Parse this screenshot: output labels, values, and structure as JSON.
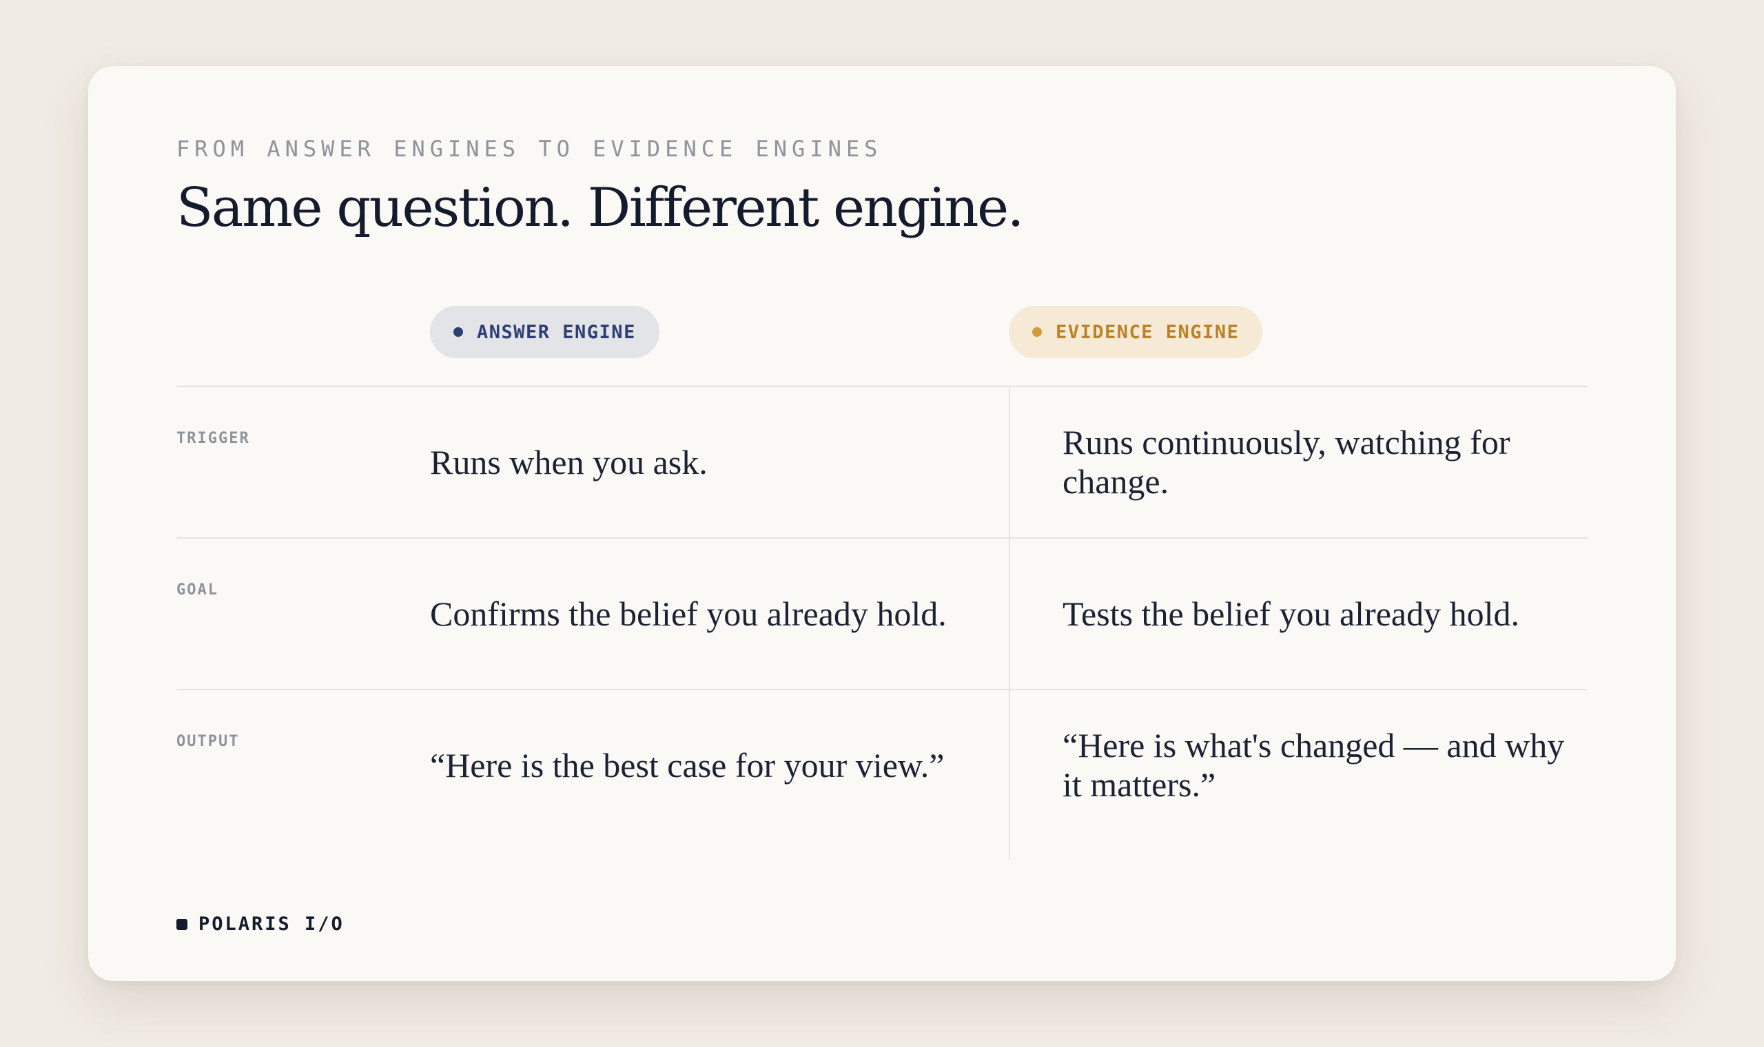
{
  "slide": {
    "eyebrow": "FROM ANSWER ENGINES TO EVIDENCE ENGINES",
    "title": "Same question. Different engine."
  },
  "columns": {
    "answer": {
      "label": "ANSWER ENGINE",
      "color": "#2e3f74",
      "background": "#e3e4e8"
    },
    "evidence": {
      "label": "EVIDENCE ENGINE",
      "color": "#b98326",
      "background": "#f6e9d6"
    }
  },
  "rows": [
    {
      "label": "TRIGGER",
      "answer": "Runs when you ask.",
      "evidence": "Runs continuously, watching for change."
    },
    {
      "label": "GOAL",
      "answer": "Confirms the belief you already hold.",
      "evidence": "Tests the belief you already hold."
    },
    {
      "label": "OUTPUT",
      "answer": "“Here is the best case for your view.”",
      "evidence": "“Here is what's changed — and why it matters.”"
    }
  ],
  "footer": {
    "brand": "POLARIS I/O",
    "icon": "square-logo-icon"
  },
  "colors": {
    "page_background": "#f0ebe4",
    "card_background": "#faf9f6",
    "text_primary": "#141b2d",
    "text_muted": "#8f939a",
    "divider": "#e6e2db"
  }
}
